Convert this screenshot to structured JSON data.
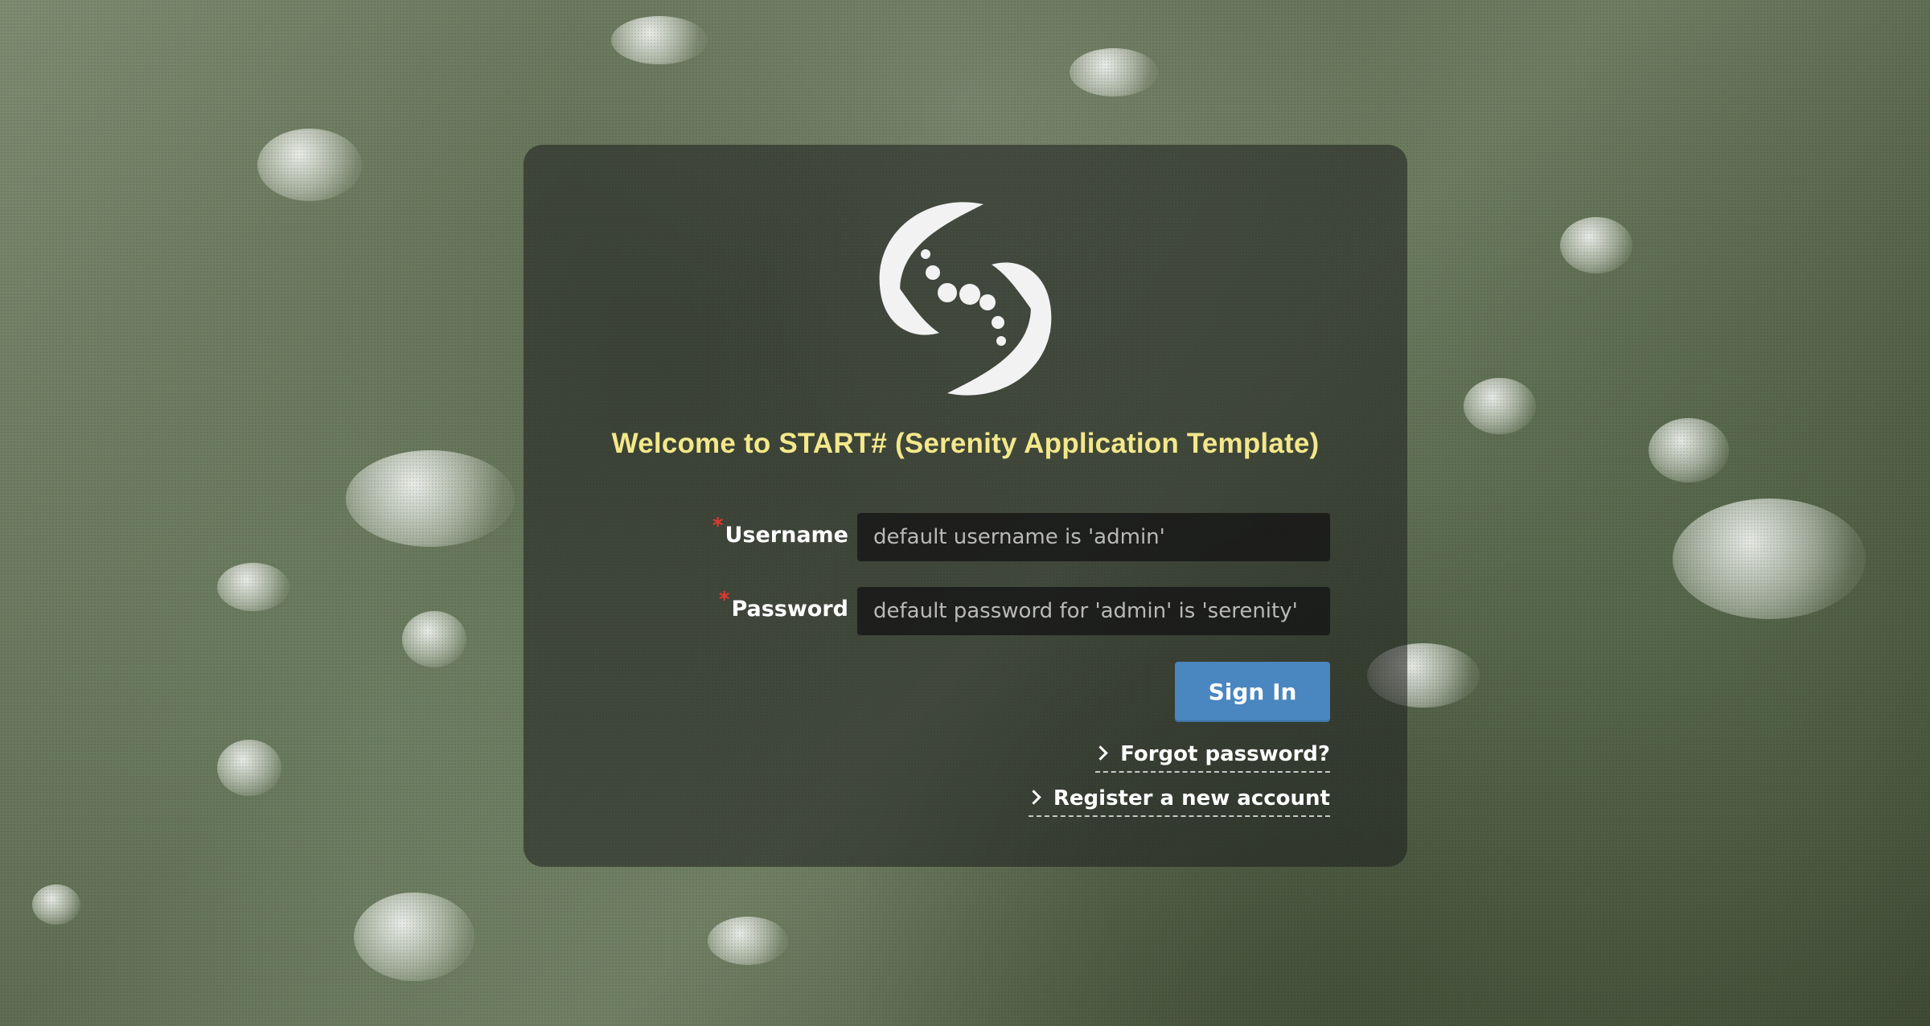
{
  "page": {
    "title": "Welcome to START# (Serenity Application Template)",
    "logo_icon": "serenity-swirl-logo"
  },
  "login_form": {
    "username": {
      "label": "Username",
      "required_marker": "*",
      "value": "",
      "placeholder": "default username is 'admin'"
    },
    "password": {
      "label": "Password",
      "required_marker": "*",
      "value": "",
      "placeholder": "default password for 'admin' is 'serenity'"
    },
    "sign_in_label": "Sign In",
    "forgot_password_label": "Forgot password?",
    "register_label": "Register a new account"
  },
  "colors": {
    "title": "#f3e88a",
    "required_marker": "#e03a2f",
    "primary_button": "#4a86bf",
    "panel_background": "rgba(30,30,30,0.55)"
  }
}
